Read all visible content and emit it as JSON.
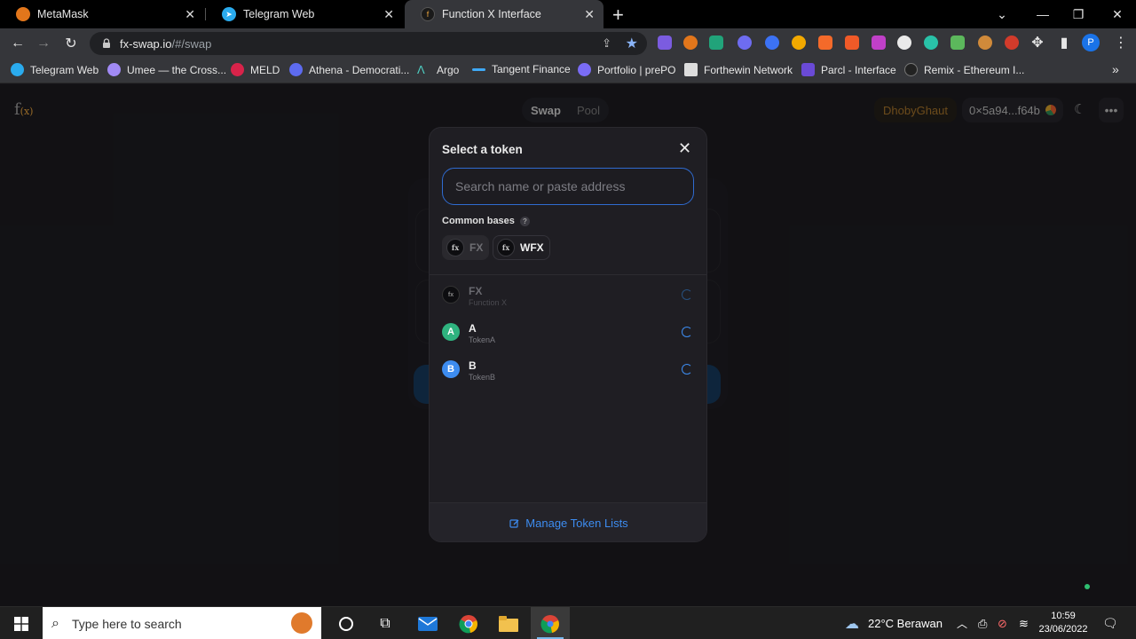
{
  "browser": {
    "tabs": [
      {
        "title": "MetaMask",
        "color": "#e2761b",
        "active": false
      },
      {
        "title": "Telegram Web",
        "color": "#2aabee",
        "active": false
      },
      {
        "title": "Function X Interface",
        "color": "#1a1a1a",
        "active": true
      }
    ],
    "url_host": "fx-swap.io",
    "url_path": "/#/swap",
    "bookmarks": [
      "Telegram Web",
      "Umee — the Cross...",
      "MELD",
      "Athena - Democrati...",
      "Argo",
      "Tangent Finance",
      "Portfolio | prePO",
      "Forthewin Network",
      "Parcl - Interface",
      "Remix - Ethereum I..."
    ],
    "profile_initial": "P"
  },
  "app": {
    "logo_main": "f",
    "logo_sub": "(x)",
    "nav": {
      "swap": "Swap",
      "pool": "Pool"
    },
    "network": "DhobyGhaut",
    "account": "0×5a94...f64b",
    "menu_glyph": "•••"
  },
  "modal": {
    "title": "Select a token",
    "search_placeholder": "Search name or paste address",
    "common_bases_label": "Common bases",
    "help_glyph": "?",
    "common_bases": [
      {
        "symbol": "FX",
        "disabled": true
      },
      {
        "symbol": "WFX",
        "disabled": false
      }
    ],
    "tokens": [
      {
        "symbol": "FX",
        "name": "Function X",
        "logo": "f(x)",
        "color": "#0d0d10",
        "dimmed": true
      },
      {
        "symbol": "A",
        "name": "TokenA",
        "logo": "A",
        "color": "#2fb37f",
        "dimmed": false
      },
      {
        "symbol": "B",
        "name": "TokenB",
        "logo": "B",
        "color": "#3d8cf0",
        "dimmed": false
      }
    ],
    "footer_link": "Manage Token Lists"
  },
  "taskbar": {
    "search_placeholder": "Type here to search",
    "weather": "22°C  Berawan",
    "time": "10:59",
    "date": "23/06/2022"
  }
}
